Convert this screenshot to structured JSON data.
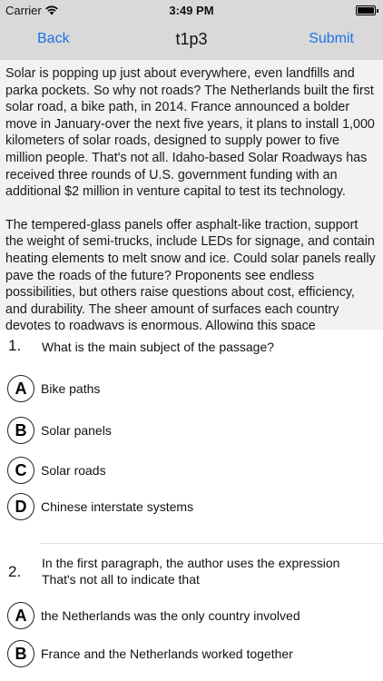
{
  "status_bar": {
    "carrier": "Carrier",
    "time": "3:49 PM"
  },
  "nav": {
    "back": "Back",
    "title": "t1p3",
    "submit": "Submit"
  },
  "passage": [
    "Solar is popping up just about everywhere, even landfills and parka pockets. So why not roads? The Netherlands built the first solar road, a bike path, in 2014. France announced a bolder move in January-over the next five years, it plans to install 1,000 kilometers of solar roads, designed to supply power to five million people. That's not all. Idaho-based Solar Roadways has received three rounds of U.S. government funding with an additional $2 million in venture capital  to test its technology.",
    "The tempered-glass panels offer asphalt-like traction, support the weight of semi-trucks, include LEDs for signage, and contain heating elements to melt snow and ice. Could solar panels really pave the roads of the future? Proponents see endless possibilities, but others raise questions about cost, efficiency, and durability. The sheer amount of surfaces each country devotes to roadways is enormous. Allowing this space"
  ],
  "questions": [
    {
      "number": "1.",
      "text": "What is the main subject of the passage?",
      "options": [
        {
          "letter": "A",
          "text": "Bike paths"
        },
        {
          "letter": "B",
          "text": "Solar panels"
        },
        {
          "letter": "C",
          "text": "Solar roads"
        },
        {
          "letter": "D",
          "text": "Chinese interstate systems"
        }
      ]
    },
    {
      "number": "2.",
      "text": "In the first paragraph, the author uses the expression That's not all to indicate that",
      "options": [
        {
          "letter": "A",
          "text": "the Netherlands was the only country involved"
        },
        {
          "letter": "B",
          "text": "France and the Netherlands worked together"
        }
      ]
    }
  ]
}
